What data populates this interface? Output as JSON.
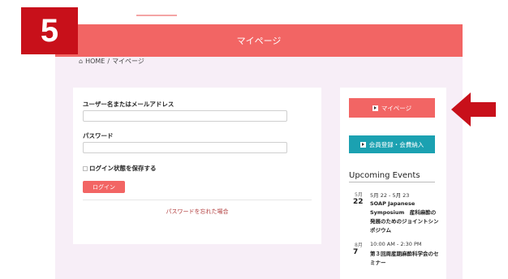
{
  "step": {
    "number": "5"
  },
  "header": {
    "title": "マイページ"
  },
  "breadcrumb": {
    "home": "HOME",
    "separator": "/",
    "current": "マイページ"
  },
  "login": {
    "username_label": "ユーザー名またはメールアドレス",
    "username_value": "",
    "password_label": "パスワード",
    "password_value": "",
    "remember_label": "ログイン状態を保存する",
    "login_button": "ログイン",
    "forgot_link": "パスワードを忘れた場合"
  },
  "sidebar": {
    "mypage_button": "マイページ",
    "register_button": "会員登録・会費納入",
    "events_heading": "Upcoming Events",
    "events": [
      {
        "month": "5月",
        "day": "22",
        "time": "5月 22 - 5月 23",
        "title": "SOAP Japanese Symposium　産科麻酔の発展のためのジョイントシンポジウム"
      },
      {
        "month": "8月",
        "day": "7",
        "time": "10:00 AM - 2:30 PM",
        "title": "第３回周産期麻酔科学会のセミナー"
      }
    ]
  },
  "colors": {
    "brand": "#f26564",
    "badge": "#c8101a",
    "register": "#1ba1b1",
    "background": "#f7eef7"
  },
  "icons": {
    "home": "home-icon",
    "mypage": "login-square-icon",
    "register": "login-square-icon",
    "arrow": "left-arrow-icon"
  }
}
